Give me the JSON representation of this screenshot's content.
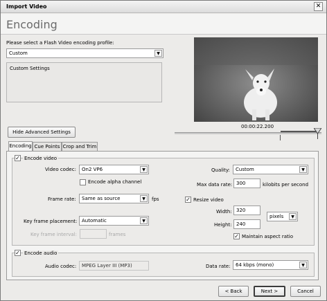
{
  "window": {
    "title": "Import Video",
    "close_glyph": "✕"
  },
  "header": {
    "title": "Encoding"
  },
  "profile": {
    "prompt": "Please select a Flash Video encoding profile:",
    "selected": "Custom",
    "description": "Custom Settings"
  },
  "preview": {
    "timecode": "00:00:22.200",
    "thumbnail": "dog-photo"
  },
  "advanced_button": "Hide Advanced Settings",
  "tabs": [
    "Encoding",
    "Cue Points",
    "Crop and Trim"
  ],
  "video": {
    "encode_label": "Encode video",
    "encode_checked": true,
    "codec_label": "Video codec:",
    "codec_value": "On2 VP6",
    "alpha_label": "Encode alpha channel",
    "alpha_checked": false,
    "frame_rate_label": "Frame rate:",
    "frame_rate_value": "Same as source",
    "fps_unit": "fps",
    "keyframe_label": "Key frame placement:",
    "keyframe_value": "Automatic",
    "keyframe_interval_label": "Key frame interval:",
    "keyframe_interval_value": "",
    "frames_unit": "frames",
    "quality_label": "Quality:",
    "quality_value": "Custom",
    "max_rate_label": "Max data rate:",
    "max_rate_value": "300",
    "max_rate_unit": "kilobits per second",
    "resize_label": "Resize video",
    "resize_checked": true,
    "width_label": "Width:",
    "width_value": "320",
    "height_label": "Height:",
    "height_value": "240",
    "units_value": "pixels",
    "aspect_label": "Maintain aspect ratio",
    "aspect_checked": true
  },
  "audio": {
    "encode_label": "Encode audio",
    "encode_checked": true,
    "codec_label": "Audio codec:",
    "codec_value": "MPEG Layer III (MP3)",
    "data_rate_label": "Data rate:",
    "data_rate_value": "64 kbps (mono)"
  },
  "buttons": {
    "back": "< Back",
    "next": "Next >",
    "cancel": "Cancel"
  },
  "check_glyph": "✓",
  "arrow_glyph": "▼"
}
